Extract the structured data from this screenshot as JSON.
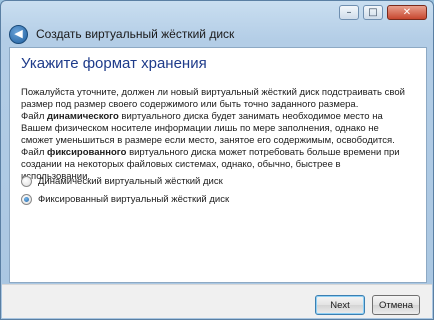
{
  "window": {
    "title": "Создать виртуальный жёсткий диск",
    "controls": {
      "minimize": "–",
      "maximize": "□",
      "close": "✕"
    },
    "back_glyph": "◀"
  },
  "page": {
    "title": "Укажите формат хранения",
    "intro": "Пожалуйста уточните, должен ли новый виртуальный жёсткий диск подстраивать свой размер под размер своего содержимого или быть точно заданного размера.",
    "dynamic_para": {
      "prefix": "Файл ",
      "keyword": "динамического",
      "text": " виртуального диска будет занимать необходимое место на Вашем физическом носителе информации лишь по мере заполнения, однако не сможет уменьшиться в размере если место, занятое его содержимым, освободится."
    },
    "fixed_para": {
      "prefix": "Файл ",
      "keyword": "фиксированного",
      "text": " виртуального диска может потребовать больше времени при создании на некоторых файловых системах, однако, обычно, быстрее в использовании."
    },
    "options": [
      {
        "label": "Динамический виртуальный жёсткий диск",
        "selected": false
      },
      {
        "label": "Фиксированный виртуальный жёсткий диск",
        "selected": true
      }
    ]
  },
  "footer": {
    "next_label": "Next",
    "cancel_label": "Отмена"
  },
  "icons": {
    "back": "back-arrow-icon",
    "minimize": "minimize-icon",
    "maximize": "maximize-icon",
    "close": "close-icon"
  },
  "colors": {
    "title_blue": "#1e3b8a",
    "frame": "#b3cde6",
    "close_red": "#c7472f"
  }
}
